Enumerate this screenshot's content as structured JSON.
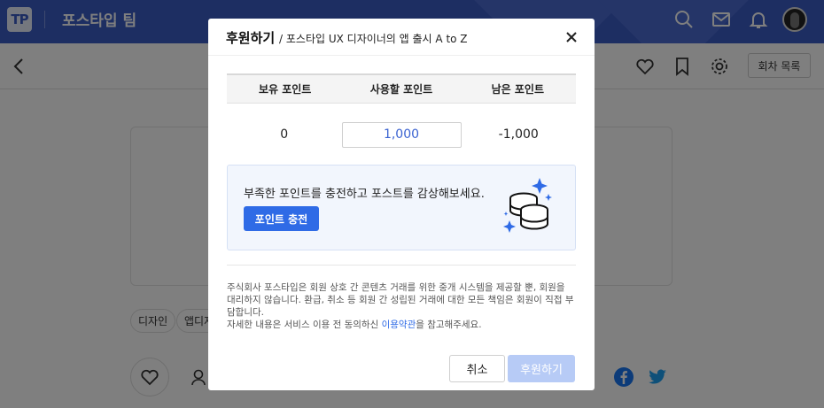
{
  "header": {
    "logo_text": "TP",
    "brand_name": "포스타입 팀"
  },
  "toolbar": {
    "episode_list_label": "회차 목록"
  },
  "post": {
    "tags": [
      "디자인",
      "앱디자"
    ]
  },
  "modal": {
    "title": "후원하기",
    "subtitle": "/ 포스타입 UX 디자이너의 앱 출시 A to Z",
    "table": {
      "headers": [
        "보유 포인트",
        "사용할 포인트",
        "남은 포인트"
      ],
      "owned_points": "0",
      "use_points": "1,000",
      "remaining_points": "-1,000"
    },
    "charge": {
      "message": "부족한 포인트를 충전하고 포스트를 감상해보세요.",
      "button_label": "포인트 충전"
    },
    "notice": {
      "line1": "주식회사 포스타입은 회원 상호 간 콘텐츠 거래를 위한 중개 시스템을 제공할 뿐, 회원을 대리하지 않습니다. 환급, 취소 등 회원 간 성립된 거래에 대한 모든 책임은 회원이 직접 부담합니다.",
      "line2_prefix": "자세한 내용은 서비스 이용 전 동의하신 ",
      "line2_link": "이용약관",
      "line2_suffix": "을 참고해주세요."
    },
    "cancel_label": "취소",
    "submit_label": "후원하기"
  },
  "colors": {
    "header_bg": "#3b5cc5",
    "accent": "#2f6be6",
    "submit_disabled": "#b7cbf6",
    "charge_box_bg": "#f2f6fd"
  }
}
